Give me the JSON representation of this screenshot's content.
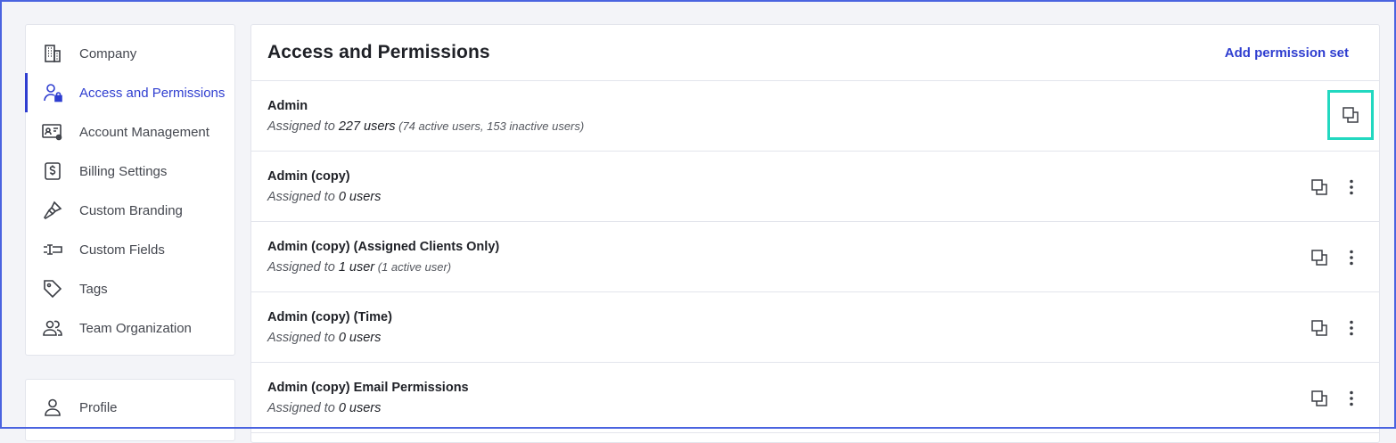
{
  "sidebar": {
    "items": [
      {
        "label": "Company",
        "icon": "building-icon"
      },
      {
        "label": "Access and Permissions",
        "icon": "user-lock-icon",
        "active": true
      },
      {
        "label": "Account Management",
        "icon": "id-card-gear-icon"
      },
      {
        "label": "Billing Settings",
        "icon": "dollar-file-icon"
      },
      {
        "label": "Custom Branding",
        "icon": "paintbrush-icon"
      },
      {
        "label": "Custom Fields",
        "icon": "text-field-icon"
      },
      {
        "label": "Tags",
        "icon": "tag-icon"
      },
      {
        "label": "Team Organization",
        "icon": "users-icon"
      }
    ],
    "secondary": [
      {
        "label": "Profile",
        "icon": "user-icon"
      }
    ]
  },
  "main": {
    "title": "Access and Permissions",
    "add_label": "Add permission set",
    "rows": [
      {
        "name": "Admin",
        "prefix": "Assigned to ",
        "count": "227 users",
        "detail": " (74 active users, 153 inactive users)"
      },
      {
        "name": "Admin (copy)",
        "prefix": "Assigned to ",
        "count": "0 users",
        "detail": ""
      },
      {
        "name": "Admin (copy) (Assigned Clients Only)",
        "prefix": "Assigned to ",
        "count": "1 user",
        "detail": " (1 active user)"
      },
      {
        "name": "Admin (copy) (Time)",
        "prefix": "Assigned to ",
        "count": "0 users",
        "detail": ""
      },
      {
        "name": "Admin (copy) Email Permissions",
        "prefix": "Assigned to ",
        "count": "0 users",
        "detail": ""
      }
    ]
  },
  "colors": {
    "accent": "#2f3ed0",
    "highlight": "#22d8c0",
    "frame": "#4a63e0"
  }
}
